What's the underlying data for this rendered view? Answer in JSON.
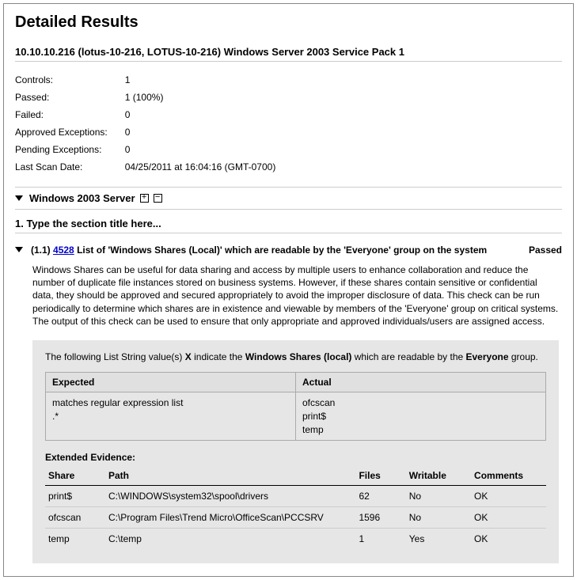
{
  "title": "Detailed Results",
  "host": "10.10.10.216 (lotus-10-216, LOTUS-10-216) Windows Server 2003 Service Pack 1",
  "summary": {
    "controls_label": "Controls:",
    "controls_value": "1",
    "passed_label": "Passed:",
    "passed_value": "1 (100%)",
    "failed_label": "Failed:",
    "failed_value": "0",
    "approved_label": "Approved Exceptions:",
    "approved_value": "0",
    "pending_label": "Pending Exceptions:",
    "pending_value": "0",
    "lastscan_label": "Last Scan Date:",
    "lastscan_value": "04/25/2011 at 16:04:16 (GMT-0700)"
  },
  "group": {
    "name": "Windows 2003 Server"
  },
  "section": {
    "title": "1. Type the section title here..."
  },
  "control": {
    "num": "(1.1)",
    "id": "4528",
    "title": "List of 'Windows Shares (Local)' which are readable by the 'Everyone' group on the system",
    "status": "Passed",
    "description": "Windows Shares can be useful for data sharing and access by multiple users to enhance collaboration and reduce the number of duplicate file instances stored on business systems. However, if these shares contain sensitive or confidential data, they should be approved and secured appropriately to avoid the improper disclosure of data. This check can be run periodically to determine which shares are in existence and viewable by members of the 'Everyone' group on critical systems. The output of this check can be used to ensure that only appropriate and approved individuals/users are assigned access."
  },
  "evidence": {
    "intro_prefix": "The following List String value(s) ",
    "intro_x": "X",
    "intro_mid": " indicate the ",
    "intro_bold1": "Windows Shares (local)",
    "intro_mid2": " which are readable by the ",
    "intro_bold2": "Everyone",
    "intro_suffix": " group.",
    "expected_header": "Expected",
    "actual_header": "Actual",
    "expected_value": "matches regular expression list\n.*",
    "actual_value": "ofcscan\nprint$\ntemp"
  },
  "extended": {
    "label": "Extended Evidence:",
    "headers": {
      "share": "Share",
      "path": "Path",
      "files": "Files",
      "writable": "Writable",
      "comments": "Comments"
    },
    "rows": [
      {
        "share": "print$",
        "path": "C:\\WINDOWS\\system32\\spool\\drivers",
        "files": "62",
        "writable": "No",
        "comments": "OK"
      },
      {
        "share": "ofcscan",
        "path": "C:\\Program Files\\Trend Micro\\OfficeScan\\PCCSRV",
        "files": "1596",
        "writable": "No",
        "comments": "OK"
      },
      {
        "share": "temp",
        "path": "C:\\temp",
        "files": "1",
        "writable": "Yes",
        "comments": "OK"
      }
    ]
  }
}
